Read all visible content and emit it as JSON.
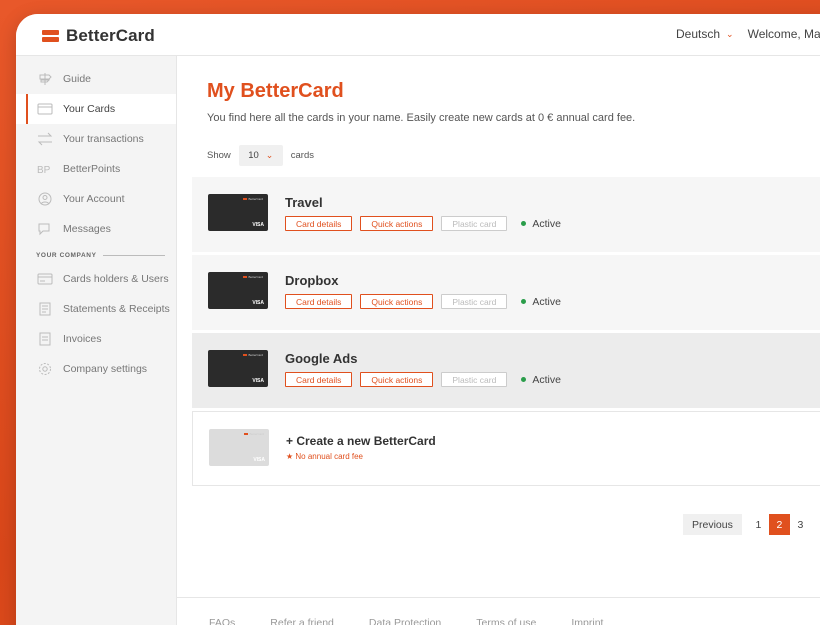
{
  "app": {
    "logo_text": "BetterCard",
    "brand_color": "#e0501e"
  },
  "header": {
    "language": "Deutsch",
    "welcome": "Welcome, Ma"
  },
  "sidebar": {
    "items": [
      {
        "label": "Guide",
        "icon": "signpost-icon",
        "active": false
      },
      {
        "label": "Your Cards",
        "icon": "card-icon",
        "active": true
      },
      {
        "label": "Your transactions",
        "icon": "transfer-arrows-icon",
        "active": false
      },
      {
        "label": "BetterPoints",
        "icon": "betterpoints-icon",
        "active": false
      },
      {
        "label": "Your Account",
        "icon": "user-icon",
        "active": false
      },
      {
        "label": "Messages",
        "icon": "chat-bubble-icon",
        "active": false
      }
    ],
    "section_label": "YOUR COMPANY",
    "company_items": [
      {
        "label": "Cards holders & Users",
        "icon": "card-users-icon"
      },
      {
        "label": "Statements & Receipts",
        "icon": "receipt-icon"
      },
      {
        "label": "Invoices",
        "icon": "invoice-icon"
      },
      {
        "label": "Company settings",
        "icon": "gear-icon"
      }
    ]
  },
  "main": {
    "title": "My BetterCard",
    "subtitle": "You find here all the cards in your name. Easily create new cards at 0 € annual card fee.",
    "show_label": "Show",
    "show_value": "10",
    "cards_label": "cards",
    "cards": [
      {
        "name": "Travel",
        "status": "Active"
      },
      {
        "name": "Dropbox",
        "status": "Active"
      },
      {
        "name": "Google Ads",
        "status": "Active"
      }
    ],
    "card_buttons": {
      "details": "Card details",
      "quick": "Quick actions",
      "plastic": "Plastic card"
    },
    "card_image": {
      "brand": "BetterCard",
      "network": "VISA"
    },
    "create": {
      "title": "+ Create a new BetterCard",
      "note": "No annual card fee"
    }
  },
  "pagination": {
    "previous": "Previous",
    "pages": [
      "1",
      "2",
      "3"
    ],
    "current": "2"
  },
  "footer": {
    "links": [
      "FAQs",
      "Refer a friend",
      "Data Protection",
      "Terms of use",
      "Imprint"
    ]
  }
}
